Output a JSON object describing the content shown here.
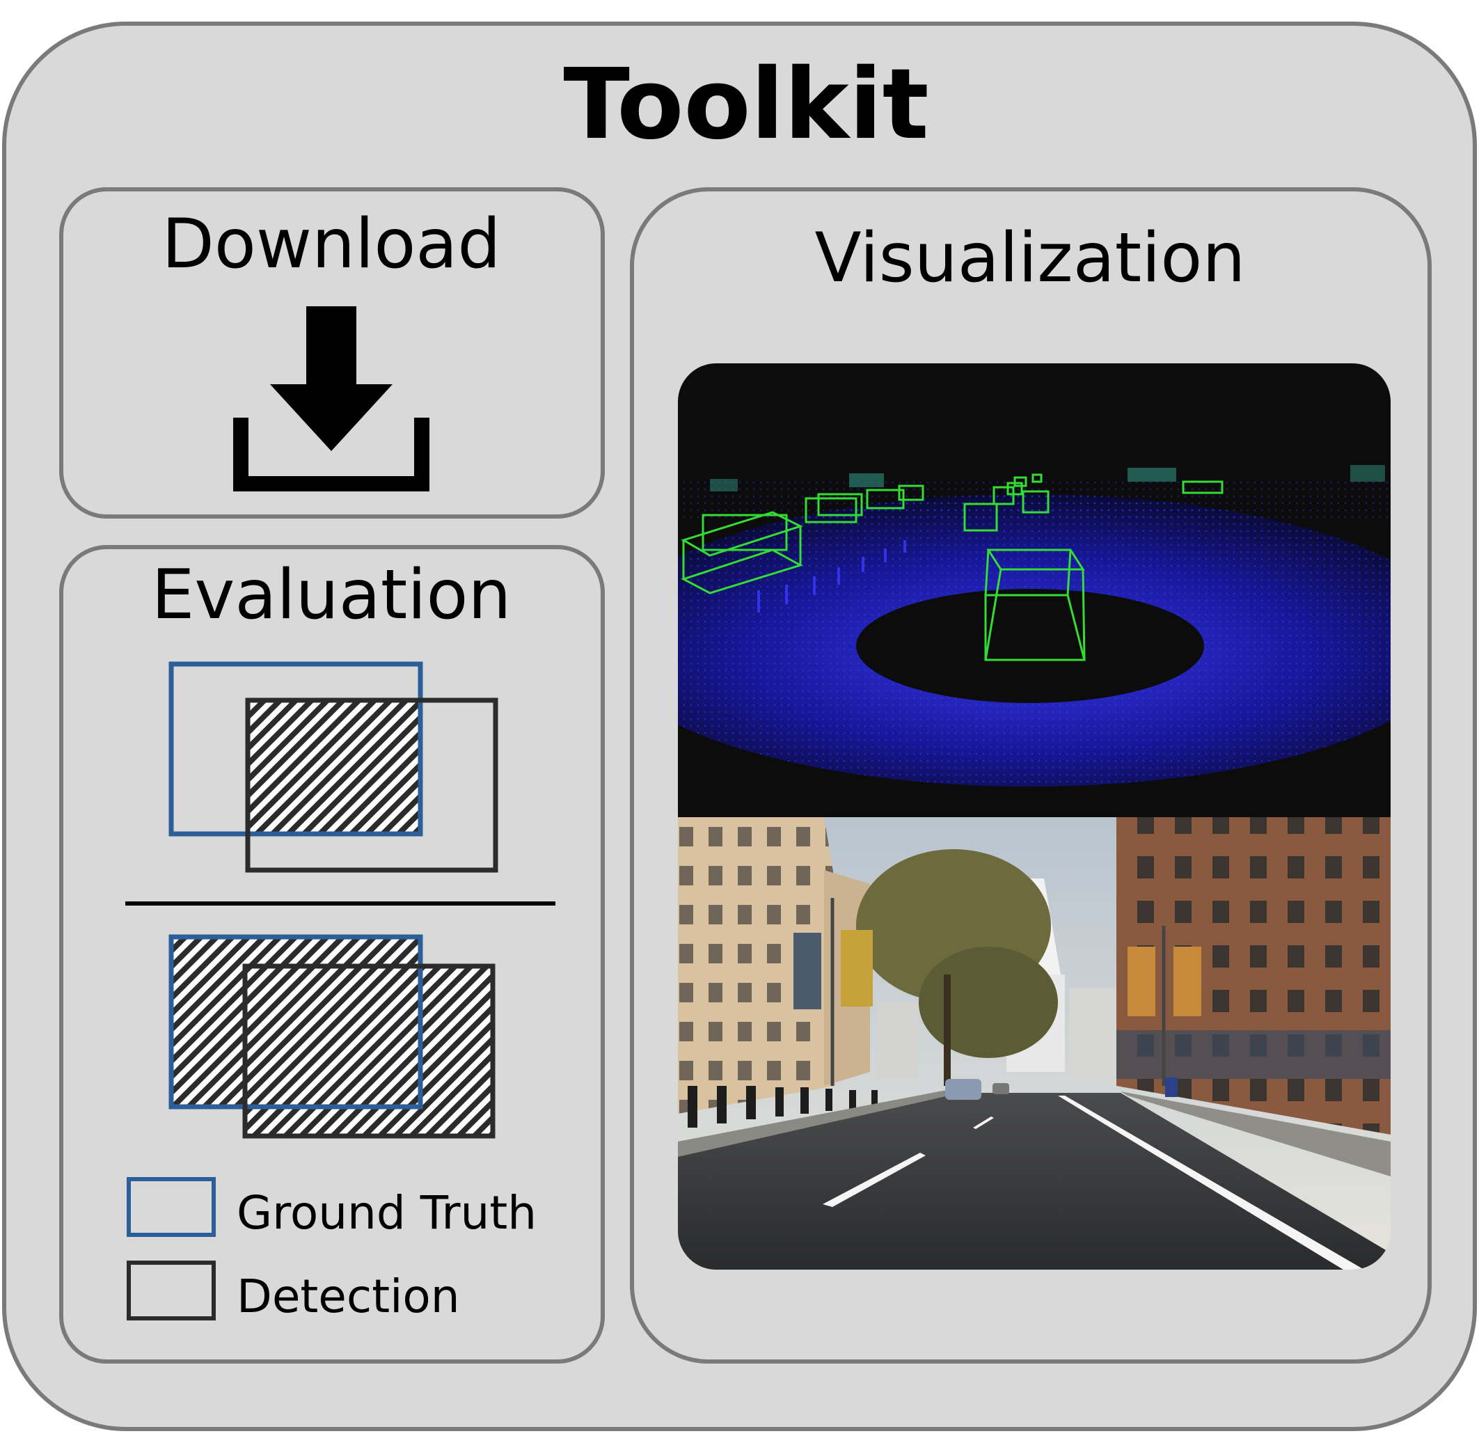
{
  "title": "Toolkit",
  "download": {
    "label": "Download",
    "icon": "download-icon"
  },
  "evaluation": {
    "label": "Evaluation",
    "legend": [
      {
        "label": "Ground Truth",
        "color": "#2c5f99"
      },
      {
        "label": "Detection",
        "color": "#2b2b2b"
      }
    ]
  },
  "visualization": {
    "label": "Visualization"
  },
  "colors": {
    "background": "#d9d9d9",
    "border": "#7a7a7a",
    "ground_truth": "#2c5f99",
    "detection": "#2b2b2b",
    "lidar_box": "#33dd33"
  }
}
